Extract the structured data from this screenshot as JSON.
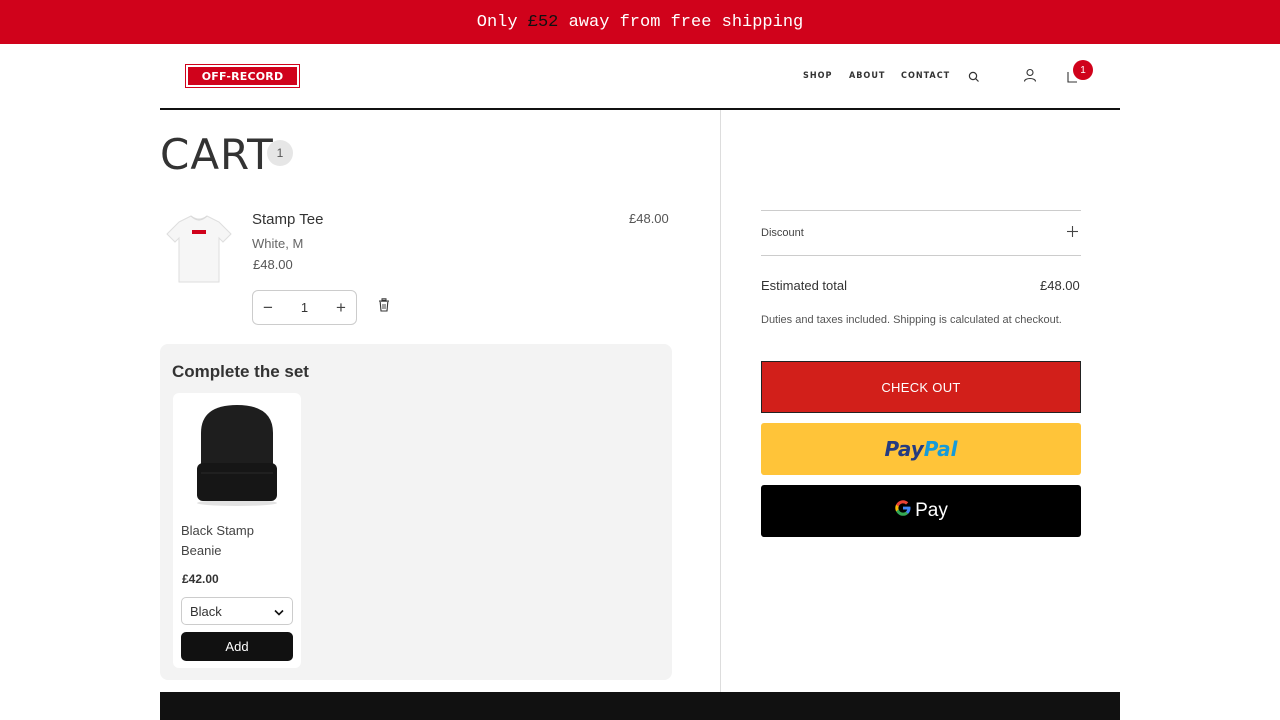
{
  "announcement": {
    "prefix": "Only ",
    "amount": "£52",
    "suffix": " away from free shipping"
  },
  "header": {
    "logo_text": "OFF-RECORD",
    "nav": [
      {
        "label": "SHOP"
      },
      {
        "label": "ABOUT"
      },
      {
        "label": "CONTACT"
      }
    ],
    "cart_count": "1",
    "icons": [
      "search-icon",
      "account-icon",
      "cart-icon"
    ]
  },
  "cart": {
    "title": "CART",
    "count": "1",
    "item": {
      "name": "Stamp Tee",
      "variant": "White, M",
      "unit_price": "£48.00",
      "line_total": "£48.00",
      "quantity": "1"
    }
  },
  "upsell": {
    "title": "Complete the set",
    "product": {
      "name": "Black Stamp Beanie",
      "price": "£42.00",
      "selected_option": "Black",
      "add_label": "Add"
    }
  },
  "summary": {
    "discount_label": "Discount",
    "estimated_total_label": "Estimated total",
    "estimated_total_value": "£48.00",
    "duties_note": "Duties and taxes included. Shipping is calculated at checkout.",
    "checkout_label": "CHECK OUT",
    "paypal_part1": "Pay",
    "paypal_part2": "Pal",
    "gpay_label": "Pay"
  },
  "colors": {
    "brand_red": "#d0021b",
    "checkout_red": "#d21f1a",
    "paypal_yellow": "#ffc439"
  }
}
